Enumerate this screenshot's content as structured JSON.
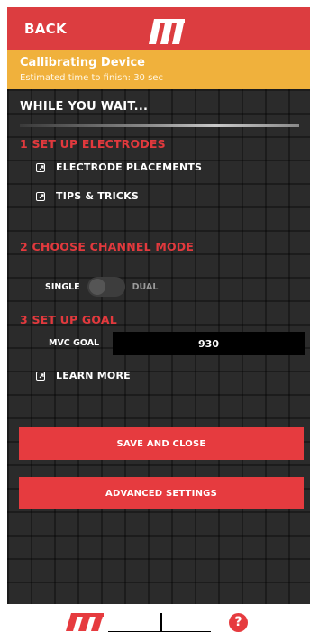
{
  "header": {
    "back_label": "BACK",
    "logo_icon": "brand-logo-icon"
  },
  "calibration": {
    "title": "Callibrating Device",
    "subtitle": "Estimated time to finish: 30 sec"
  },
  "wait": {
    "title": "WHILE YOU WAIT..."
  },
  "sections": {
    "electrodes": {
      "title": "1  SET UP ELECTRODES",
      "links": [
        "ELECTRODE PLACEMENTS",
        "TIPS & TRICKS"
      ]
    },
    "channel": {
      "title": "2  CHOOSE CHANNEL MODE",
      "single_label": "SINGLE",
      "dual_label": "DUAL",
      "mode": "single"
    },
    "goal": {
      "title": "3  SET UP GOAL",
      "mvc_label": "MVC GOAL",
      "mvc_value": "930",
      "learn_more": "LEARN MORE"
    }
  },
  "buttons": {
    "save_close": "SAVE AND CLOSE",
    "advanced": "ADVANCED SETTINGS"
  },
  "footer": {
    "logo_icon": "brand-logo-icon",
    "help_label": "?"
  },
  "colors": {
    "red": "#e63b3f",
    "header_red": "#dc3d40",
    "orange": "#f0b13c",
    "panel": "#2b2b2b"
  }
}
